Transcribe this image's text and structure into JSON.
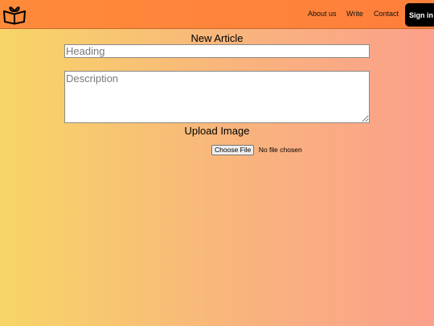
{
  "nav": {
    "logo_icon": "open-book-gift-icon",
    "links": [
      {
        "label": "About us"
      },
      {
        "label": "Write"
      },
      {
        "label": "Contact"
      }
    ],
    "signin_label": "Sign in",
    "background": "#ff8a3a"
  },
  "form": {
    "title": "New Article",
    "heading_placeholder": "Heading",
    "description_placeholder": "Description",
    "upload_title": "Upload Image",
    "file_button_label": "Choose File",
    "file_status": "No file chosen"
  },
  "colors": {
    "gradient_left": "#f7d567",
    "gradient_right": "#fba08a",
    "signin_bg": "#000000"
  }
}
